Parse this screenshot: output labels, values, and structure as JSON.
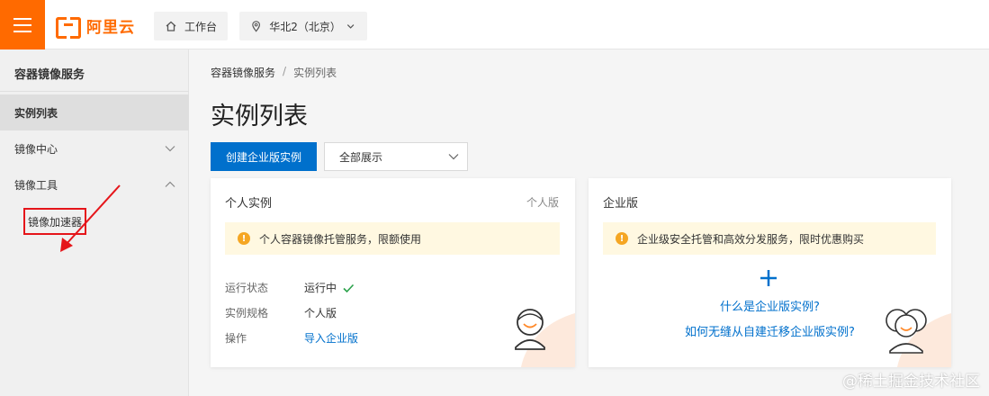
{
  "topbar": {
    "brand": "阿里云",
    "workbench": "工作台",
    "region": "华北2（北京）"
  },
  "sidebar": {
    "title": "容器镜像服务",
    "items": [
      {
        "label": "实例列表"
      },
      {
        "label": "镜像中心"
      },
      {
        "label": "镜像工具"
      }
    ],
    "sub_item": "镜像加速器"
  },
  "breadcrumb": {
    "root": "容器镜像服务",
    "sep": "/",
    "current": "实例列表"
  },
  "page": {
    "title": "实例列表",
    "create_label": "创建企业版实例",
    "filter_value": "全部展示"
  },
  "personal": {
    "title": "个人实例",
    "tag": "个人版",
    "notice": "个人容器镜像托管服务，限额使用",
    "rows": [
      {
        "key": "运行状态",
        "value": "运行中"
      },
      {
        "key": "实例规格",
        "value": "个人版"
      },
      {
        "key": "操作",
        "value": "导入企业版"
      }
    ]
  },
  "enterprise": {
    "title": "企业版",
    "notice": "企业级安全托管和高效分发服务，限时优惠购买",
    "link1": "什么是企业版实例?",
    "link2": "如何无缝从自建迁移企业版实例?"
  },
  "watermark": "@稀土掘金技术社区",
  "colors": {
    "brand": "#ff6a00",
    "primary": "#0070cc",
    "annotation": "#e5151a",
    "notice_bg": "#fff8e1",
    "success": "#2aa14a"
  }
}
